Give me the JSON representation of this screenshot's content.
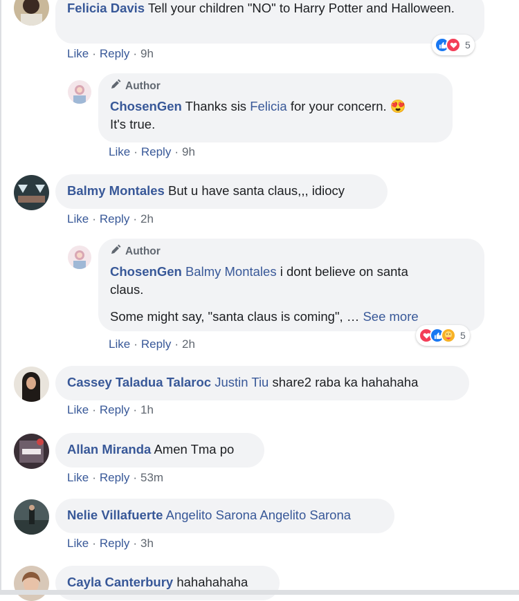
{
  "colors": {
    "link": "#385898",
    "meta": "#606770",
    "bubble": "#f2f3f5"
  },
  "comments": [
    {
      "author": "Felicia Davis",
      "text": "Tell your children \"NO\" to Harry Potter and Halloween.",
      "actions": {
        "like": "Like",
        "reply": "Reply",
        "time": "9h"
      },
      "reactions": {
        "icons": [
          "like-icon",
          "love-icon"
        ],
        "count": "5"
      }
    },
    {
      "badge": "Author",
      "author": "ChosenGen",
      "text_before": "Thanks sis",
      "mention": "Felicia",
      "text_after": "for your concern.",
      "emoji": "😍",
      "text_line2": "It's true.",
      "actions": {
        "like": "Like",
        "reply": "Reply",
        "time": "9h"
      }
    },
    {
      "author": "Balmy Montales",
      "text": "But u have santa claus,,, idiocy",
      "actions": {
        "like": "Like",
        "reply": "Reply",
        "time": "2h"
      }
    },
    {
      "badge": "Author",
      "author": "ChosenGen",
      "mention": "Balmy Montales",
      "text_after": "i dont believe on santa",
      "text_line2": "claus.",
      "text_line3": "Some might say, \"santa claus is coming\", …",
      "see_more": "See more",
      "actions": {
        "like": "Like",
        "reply": "Reply",
        "time": "2h"
      },
      "reactions": {
        "icons": [
          "love-icon",
          "like-icon",
          "care-icon"
        ],
        "count": "5"
      }
    },
    {
      "author": "Cassey Taladua Talaroc",
      "mention": "Justin Tiu",
      "text": "share2 raba ka hahahaha",
      "actions": {
        "like": "Like",
        "reply": "Reply",
        "time": "1h"
      }
    },
    {
      "author": "Allan Miranda",
      "text": "Amen Tma po",
      "actions": {
        "like": "Like",
        "reply": "Reply",
        "time": "53m"
      }
    },
    {
      "author": "Nelie Villafuerte",
      "mention": "Angelito Sarona Angelito Sarona",
      "actions": {
        "like": "Like",
        "reply": "Reply",
        "time": "3h"
      }
    },
    {
      "author": "Cayla Canterbury",
      "text": "hahahahaha"
    }
  ]
}
